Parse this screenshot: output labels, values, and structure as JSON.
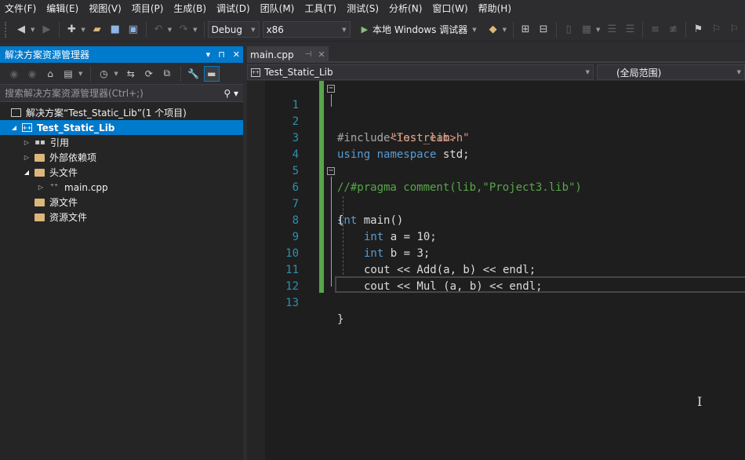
{
  "menu": [
    "文件(F)",
    "编辑(E)",
    "视图(V)",
    "项目(P)",
    "生成(B)",
    "调试(D)",
    "团队(M)",
    "工具(T)",
    "测试(S)",
    "分析(N)",
    "窗口(W)",
    "帮助(H)"
  ],
  "toolbar": {
    "config": "Debug",
    "platform": "x86",
    "run_label": "本地 Windows 调试器"
  },
  "solution_explorer": {
    "title": "解决方案资源管理器",
    "search_placeholder": "搜索解决方案资源管理器(Ctrl+;)",
    "items": [
      {
        "label": "解决方案“Test_Static_Lib”(1 个项目)",
        "icon": "solution-icon"
      },
      {
        "label": "Test_Static_Lib",
        "icon": "project-icon",
        "selected": true
      },
      {
        "label": "引用",
        "icon": "references-icon"
      },
      {
        "label": "外部依赖项",
        "icon": "external-deps-icon"
      },
      {
        "label": "头文件",
        "icon": "folder-icon"
      },
      {
        "label": "main.cpp",
        "icon": "cpp-file-icon"
      },
      {
        "label": "源文件",
        "icon": "folder-icon"
      },
      {
        "label": "资源文件",
        "icon": "folder-icon"
      }
    ]
  },
  "editor": {
    "tab": "main.cpp",
    "project_combo": "Test_Static_Lib",
    "scope_combo": "(全局范围)",
    "line_numbers": [
      "1",
      "2",
      "3",
      "4",
      "5",
      "6",
      "7",
      "8",
      "9",
      "10",
      "11",
      "12",
      "13"
    ],
    "code": {
      "l1_pp": "#include",
      "l1_str": "<iostream>",
      "l2_pp": "#include",
      "l2_str": "\"Test_lib.h\"",
      "l3_kw1": "using",
      "l3_kw2": "namespace",
      "l3_rest": " std;",
      "l5_cm": "//#pragma comment(lib,\"Project3.lib\")",
      "l6_kw": "int",
      "l6_rest": " main()",
      "l7": "{",
      "l8_kw": "int",
      "l8_rest": " a = 10;",
      "l9_kw": "int",
      "l9_rest": " b = 3;",
      "l10": "cout << Add(a, b) << endl;",
      "l11": "cout << Mul (a, b) << endl;",
      "l13": "}"
    }
  }
}
